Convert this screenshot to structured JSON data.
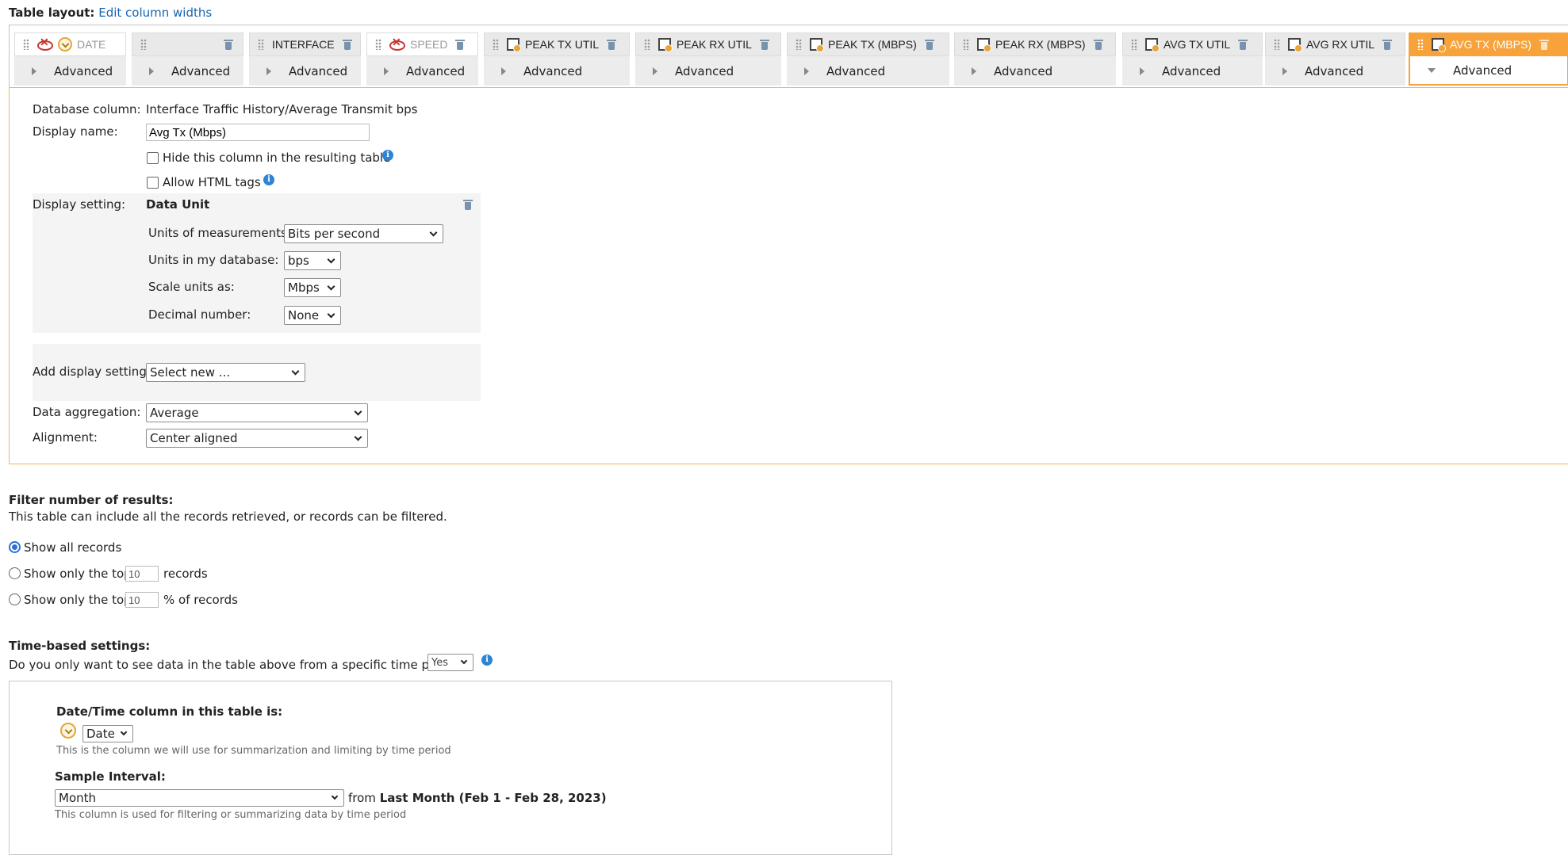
{
  "header": {
    "label": "Table layout:",
    "edit_link": "Edit column widths"
  },
  "columns": [
    {
      "label": "DATE",
      "advanced": "Advanced"
    },
    {
      "label": "",
      "advanced": "Advanced"
    },
    {
      "label": "INTERFACE",
      "advanced": "Advanced"
    },
    {
      "label": "SPEED",
      "advanced": "Advanced"
    },
    {
      "label": "PEAK TX UTIL",
      "advanced": "Advanced"
    },
    {
      "label": "PEAK RX UTIL",
      "advanced": "Advanced"
    },
    {
      "label": "PEAK TX (MBPS)",
      "advanced": "Advanced"
    },
    {
      "label": "PEAK RX (MBPS)",
      "advanced": "Advanced"
    },
    {
      "label": "AVG TX UTIL",
      "advanced": "Advanced"
    },
    {
      "label": "AVG RX UTIL",
      "advanced": "Advanced"
    },
    {
      "label": "AVG TX (MBPS)",
      "advanced": "Advanced"
    }
  ],
  "detail": {
    "db_column_label": "Database column:",
    "db_column_value": "Interface Traffic History/Average Transmit bps",
    "display_name_label": "Display name:",
    "display_name_value": "Avg Tx (Mbps)",
    "hide_label": "Hide this column in the resulting table",
    "html_label": "Allow HTML tags",
    "display_setting_label": "Display setting:",
    "data_unit_title": "Data Unit",
    "units_measure_label": "Units of measurements:",
    "units_measure_value": "Bits per second",
    "units_db_label": "Units in my database:",
    "units_db_value": "bps",
    "scale_label": "Scale units as:",
    "scale_value": "Mbps",
    "decimal_label": "Decimal number:",
    "decimal_value": "None",
    "add_display_label": "Add display settings:",
    "add_display_value": "Select new ...",
    "aggregation_label": "Data aggregation:",
    "aggregation_value": "Average",
    "alignment_label": "Alignment:",
    "alignment_value": "Center aligned"
  },
  "filter": {
    "title": "Filter number of results:",
    "desc": "This table can include all the records retrieved, or records can be filtered.",
    "show_all": "Show all records",
    "top_prefix": "Show only the top",
    "top_value": "10",
    "top_suffix": "records",
    "pct_prefix": "Show only the top",
    "pct_value": "10",
    "pct_suffix": "% of records"
  },
  "time": {
    "title": "Time-based settings:",
    "question": "Do you only want to see data in the table above from a specific time period?",
    "answer": "Yes",
    "dt_title": "Date/Time column in this table is:",
    "dt_value": "Date",
    "dt_hint": "This is the column we will use for summarization and limiting by time period",
    "sample_title": "Sample Interval:",
    "sample_value": "Month",
    "from_text": "from",
    "range_text": "Last Month (Feb 1 - Feb 28, 2023)",
    "sample_hint": "This column is used for filtering or summarizing data by time period"
  }
}
